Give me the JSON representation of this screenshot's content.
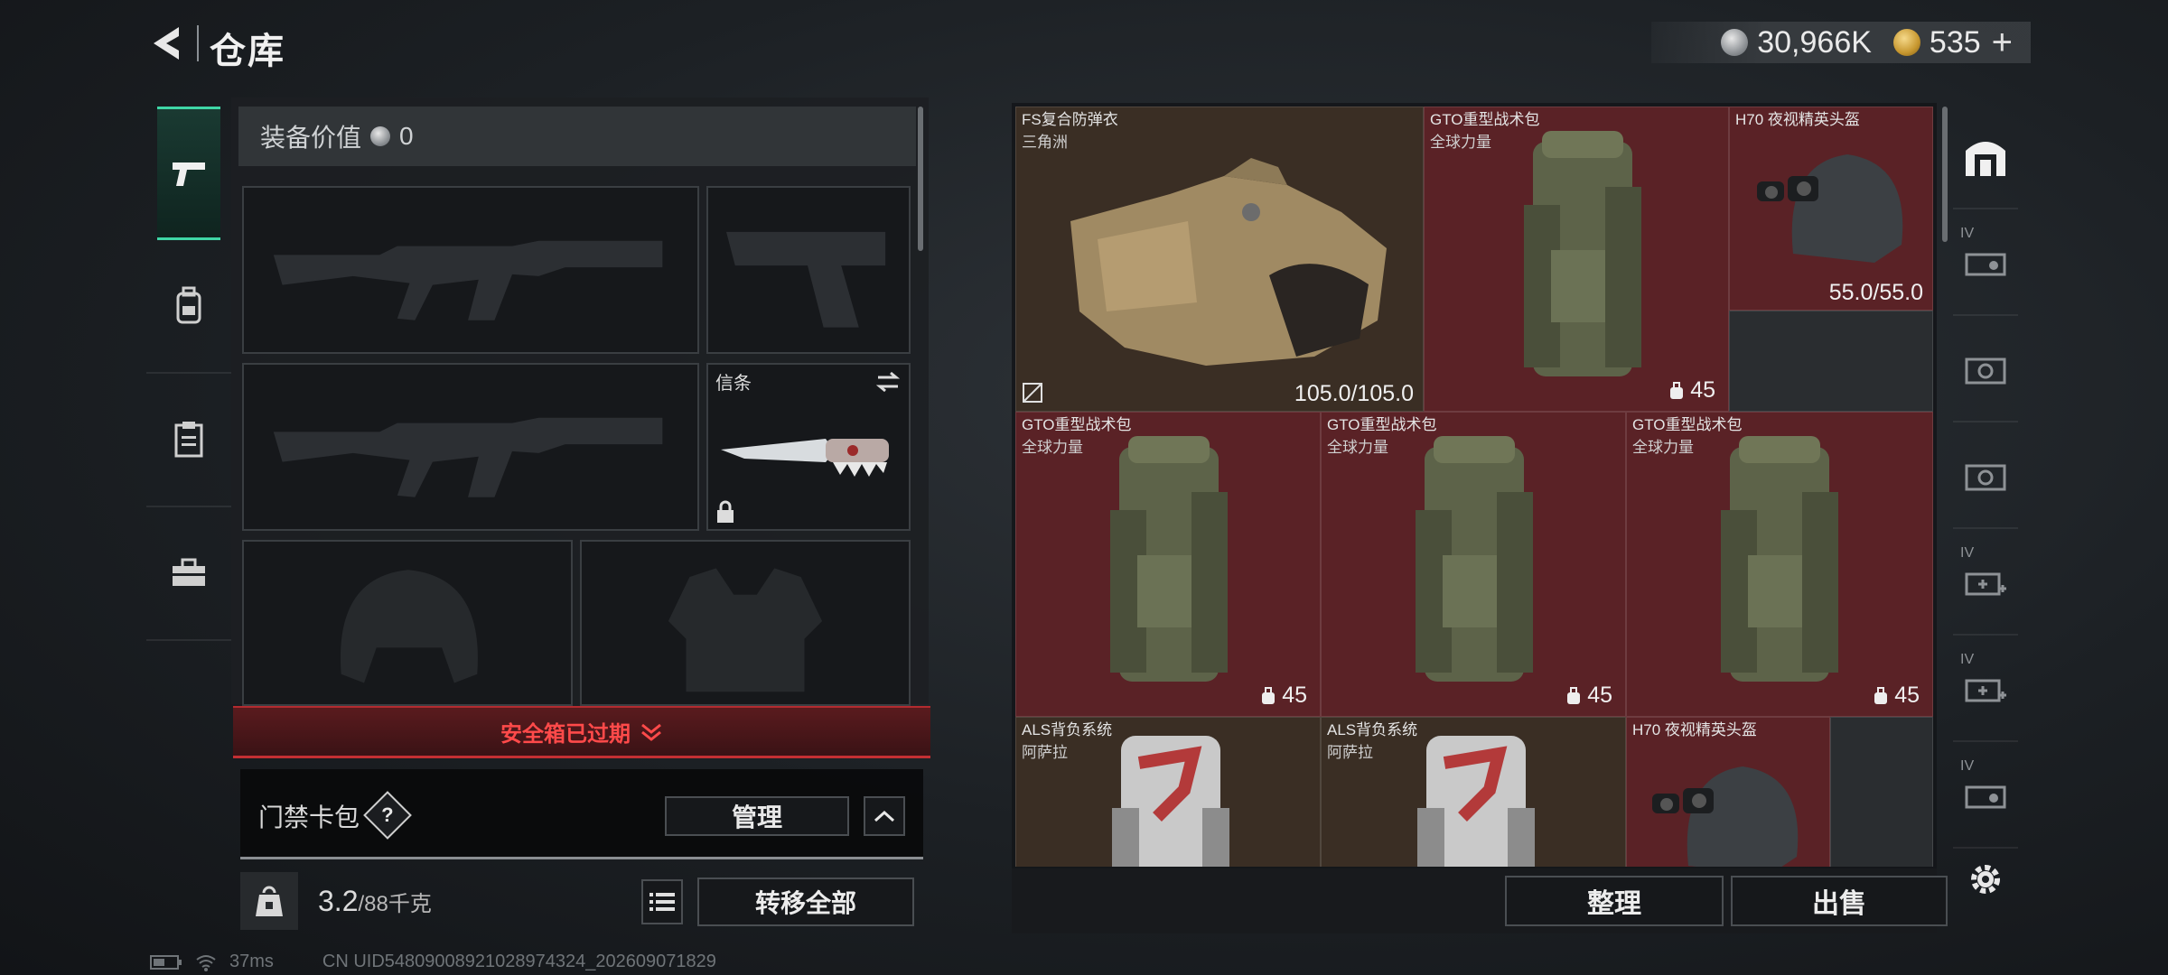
{
  "header": {
    "title": "仓库"
  },
  "currency": {
    "silver_amount": "30,966K",
    "gold_amount": "535"
  },
  "left_tabs": [
    {
      "icon": "pistol-icon",
      "active": true
    },
    {
      "icon": "backpack-icon",
      "active": false
    },
    {
      "icon": "clipboard-icon",
      "active": false
    },
    {
      "icon": "toolbox-icon",
      "active": false
    }
  ],
  "loadout": {
    "equip_value_label": "装备价值",
    "equip_value": "0",
    "melee_slot_label": "信条",
    "expired_text": "安全箱已过期",
    "keycard_label": "门禁卡包",
    "help_mark": "?",
    "manage_label": "管理",
    "weight_value": "3.2",
    "weight_capacity": "/88千克",
    "transfer_all_label": "转移全部"
  },
  "status_bar": {
    "ping": "37ms",
    "uid": "CN UID5480900892102897432​4_202609071829"
  },
  "stash_items": [
    {
      "name": "FS复合防弹衣",
      "sub": "三角洲",
      "value": "105.0/105.0"
    },
    {
      "name": "GTO重型战术包",
      "sub": "全球力量",
      "capacity": "45"
    },
    {
      "name": "H70 夜视精英头盔",
      "sub": "",
      "value": "55.0/55.0"
    },
    {
      "name": "GTO重型战术包",
      "sub": "全球力量",
      "capacity": "45"
    },
    {
      "name": "GTO重型战术包",
      "sub": "全球力量",
      "capacity": "45"
    },
    {
      "name": "GTO重型战术包",
      "sub": "全球力量",
      "capacity": "45"
    },
    {
      "name": "ALS背负系统",
      "sub": "阿萨拉"
    },
    {
      "name": "ALS背负系统",
      "sub": "阿萨拉"
    },
    {
      "name": "H70 夜视精英头盔",
      "sub": ""
    }
  ],
  "right_tabs": [
    {
      "icon": "storage-icon",
      "label": ""
    },
    {
      "icon": "stash-tab-icon",
      "label": "IV"
    },
    {
      "icon": "camera-tab-icon",
      "label": ""
    },
    {
      "icon": "camera-tab-icon",
      "label": ""
    },
    {
      "icon": "medical-tab-icon",
      "label": "IV"
    },
    {
      "icon": "medical-tab-icon",
      "label": "IV"
    },
    {
      "icon": "stash-tab-icon",
      "label": "IV"
    }
  ],
  "actions": {
    "sort_label": "整理",
    "sell_label": "出售"
  },
  "colors": {
    "accent": "#3fd6a6",
    "alert_red": "#ff4a4a",
    "item_red": "#5a2226",
    "item_brown": "#3a2e24"
  }
}
